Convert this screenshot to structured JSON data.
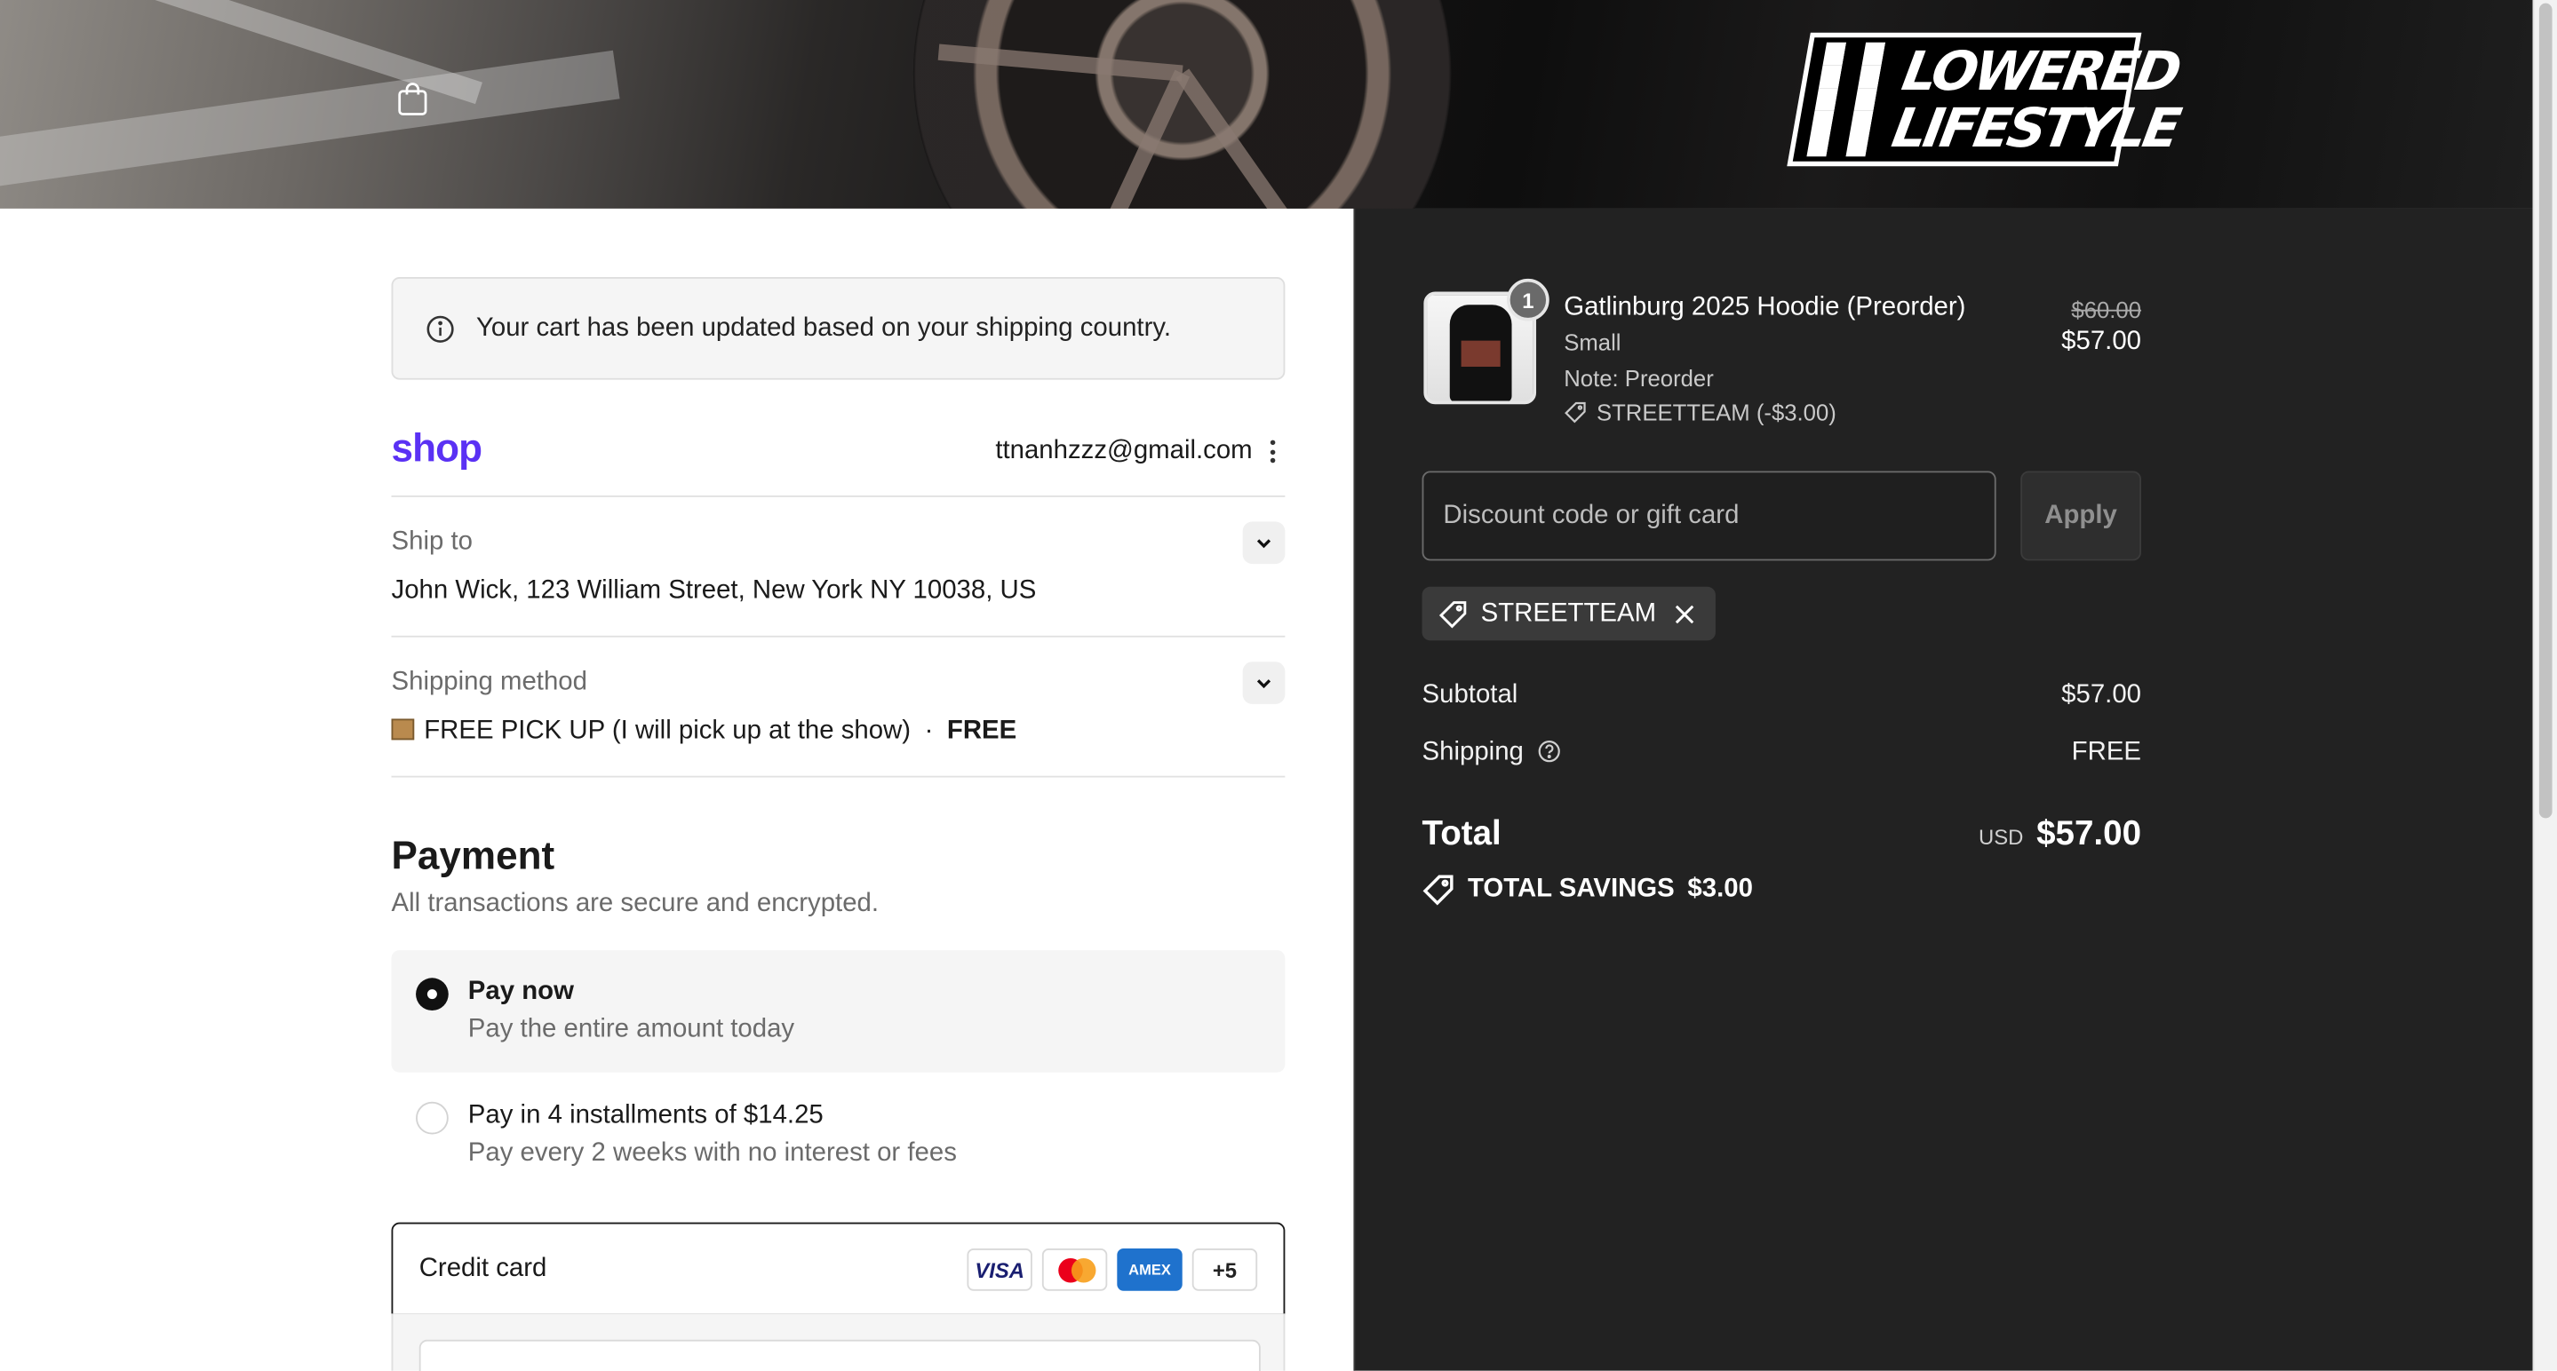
{
  "banner": {
    "logo_text_line1": "LOWERED",
    "logo_text_line2": "LIFESTYLE",
    "cart_icon": "shopping-bag-icon"
  },
  "notice": {
    "icon": "info-icon",
    "text": "Your cart has been updated based on your shipping country."
  },
  "account": {
    "shop_logo": "shop",
    "email": "ttnanhzzz@gmail.com",
    "menu_icon": "kebab-menu-icon"
  },
  "ship_to": {
    "label": "Ship to",
    "value": "John Wick, 123 William Street, New York NY 10038, US"
  },
  "shipping_method": {
    "label": "Shipping method",
    "value": "FREE PICK UP (I will pick up at the show)",
    "separator": "·",
    "price": "FREE"
  },
  "payment": {
    "title": "Payment",
    "subtitle": "All transactions are secure and encrypted.",
    "options": [
      {
        "title": "Pay now",
        "subtitle": "Pay the entire amount today",
        "selected": true
      },
      {
        "title": "Pay in 4 installments of $14.25",
        "subtitle": "Pay every 2 weeks with no interest or fees",
        "selected": false
      }
    ],
    "credit_card": {
      "label": "Credit card",
      "brands": [
        "VISA",
        "Mastercard",
        "AMEX"
      ],
      "more": "+5"
    }
  },
  "summary": {
    "item": {
      "name": "Gatlinburg 2025 Hoodie (Preorder)",
      "variant": "Small",
      "note": "Note: Preorder",
      "discount": "STREETTEAM (-$3.00)",
      "quantity": "1",
      "original_price": "$60.00",
      "price": "$57.00"
    },
    "discount_input": {
      "placeholder": "Discount code or gift card",
      "value": ""
    },
    "apply_label": "Apply",
    "applied_code": "STREETTEAM",
    "subtotal_label": "Subtotal",
    "subtotal_value": "$57.00",
    "shipping_label": "Shipping",
    "shipping_value": "FREE",
    "total_label": "Total",
    "total_currency": "USD",
    "total_value": "$57.00",
    "savings_label": "TOTAL SAVINGS",
    "savings_value": "$3.00"
  },
  "colors": {
    "shop_brand": "#5a31f4",
    "summary_bg": "#222222",
    "selected_option_bg": "#f5f5f5"
  }
}
